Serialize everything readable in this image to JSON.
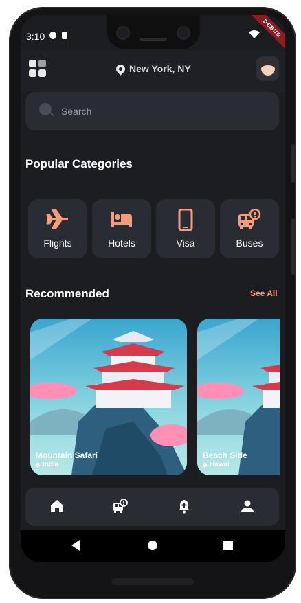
{
  "status_bar": {
    "time": "3:10",
    "debug_banner": "DEBUG"
  },
  "header": {
    "location": "New York, NY"
  },
  "search": {
    "placeholder": "Search"
  },
  "popular": {
    "title": "Popular Categories",
    "categories": [
      {
        "label": "Flights",
        "icon": "airplane-icon"
      },
      {
        "label": "Hotels",
        "icon": "bed-icon"
      },
      {
        "label": "Visa",
        "icon": "phone-icon"
      },
      {
        "label": "Buses",
        "icon": "bus-alert-icon"
      }
    ]
  },
  "recommended": {
    "title": "Recommended",
    "see_all": "See All",
    "cards": [
      {
        "title": "Mountain Safari",
        "location": "India"
      },
      {
        "title": "Beach Side",
        "location": "Hawai"
      }
    ]
  },
  "bottom_nav": {
    "items": [
      {
        "icon": "home-icon"
      },
      {
        "icon": "bus-alert-icon"
      },
      {
        "icon": "bell-plus-icon"
      },
      {
        "icon": "person-icon"
      }
    ]
  },
  "colors": {
    "accent": "#F59C7B",
    "background": "#1C1D21",
    "surface": "#2A2C34"
  }
}
